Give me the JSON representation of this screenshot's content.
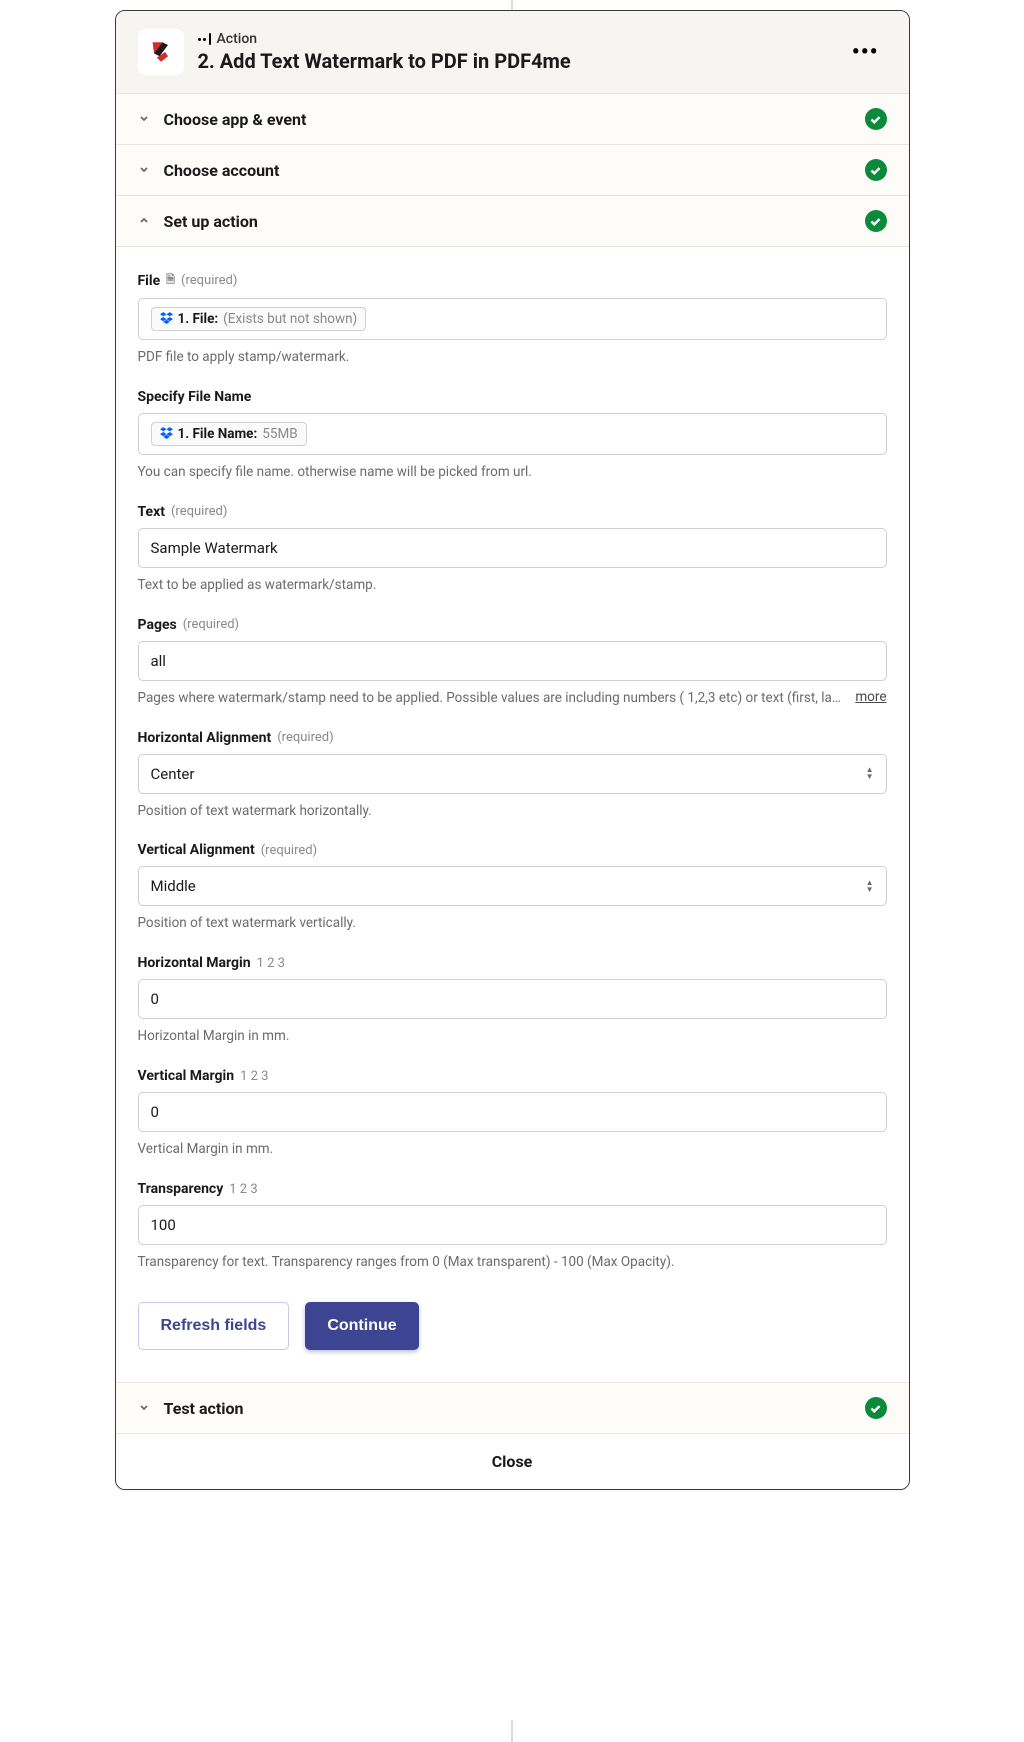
{
  "header": {
    "eyebrow": "Action",
    "title": "2. Add Text Watermark to PDF in PDF4me"
  },
  "sections": {
    "app_event": {
      "label": "Choose app & event",
      "expanded": false,
      "complete": true
    },
    "account": {
      "label": "Choose account",
      "expanded": false,
      "complete": true
    },
    "setup": {
      "label": "Set up action",
      "expanded": true,
      "complete": true
    },
    "test": {
      "label": "Test action",
      "expanded": false,
      "complete": true
    }
  },
  "fields": {
    "file": {
      "label": "File",
      "required": "(required)",
      "pill_prefix": "1. File:",
      "pill_value": "(Exists but not shown)",
      "help": "PDF file to apply stamp/watermark."
    },
    "filename": {
      "label": "Specify File Name",
      "pill_prefix": "1. File Name:",
      "pill_value": "55MB",
      "help": "You can specify file name. otherwise name will be picked from url."
    },
    "text": {
      "label": "Text",
      "required": "(required)",
      "value": "Sample Watermark",
      "help": "Text to be applied as watermark/stamp."
    },
    "pages": {
      "label": "Pages",
      "required": "(required)",
      "value": "all",
      "help": "Pages where watermark/stamp need to be applied. Possible values are including numbers ( 1,2,3 etc) or text (first, las...",
      "more": "more"
    },
    "halign": {
      "label": "Horizontal Alignment",
      "required": "(required)",
      "value": "Center",
      "help": "Position of text watermark horizontally."
    },
    "valign": {
      "label": "Vertical Alignment",
      "required": "(required)",
      "value": "Middle",
      "help": "Position of text watermark vertically."
    },
    "hmargin": {
      "label": "Horizontal Margin",
      "hint": "1 2 3",
      "value": "0",
      "help": "Horizontal Margin in mm."
    },
    "vmargin": {
      "label": "Vertical Margin",
      "hint": "1 2 3",
      "value": "0",
      "help": "Vertical Margin in mm."
    },
    "transparency": {
      "label": "Transparency",
      "hint": "1 2 3",
      "value": "100",
      "help": "Transparency for text. Transparency ranges from 0 (Max transparent) - 100 (Max Opacity)."
    }
  },
  "buttons": {
    "refresh": "Refresh fields",
    "continue": "Continue"
  },
  "footer": {
    "close": "Close"
  }
}
